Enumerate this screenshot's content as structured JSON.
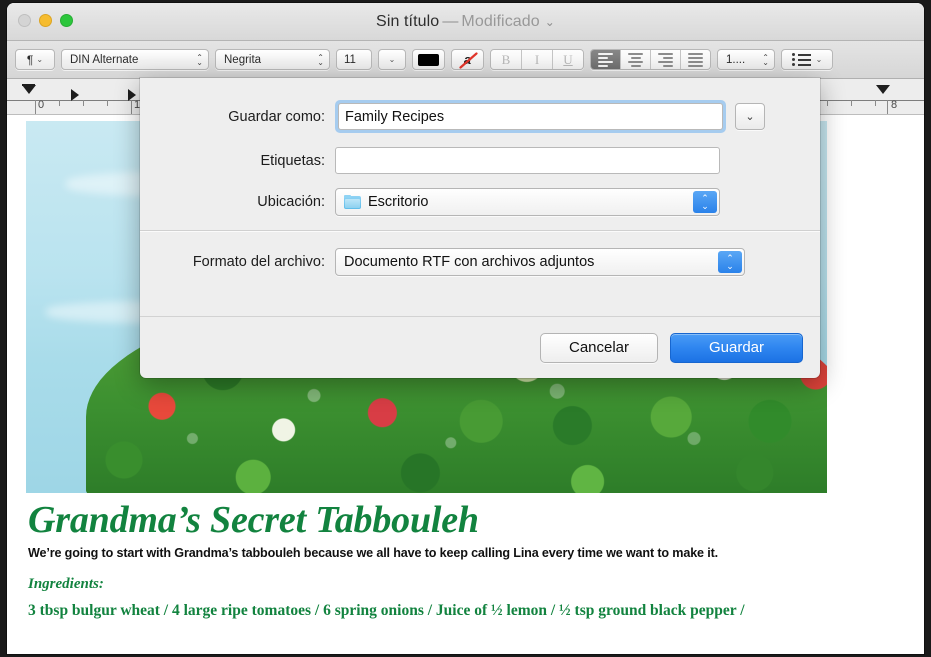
{
  "window": {
    "title_name": "Sin título",
    "title_dash": "—",
    "title_modified": "Modificado",
    "title_chevron": "⌄"
  },
  "traffic_lights": {
    "close": "close-button",
    "minimize": "minimize-button",
    "maximize": "maximize-button"
  },
  "toolbar": {
    "paragraph_glyph": "¶",
    "paragraph_chevron": "⌄",
    "font_family": "DIN Alternate",
    "font_style": "Negrita",
    "font_size": "11",
    "font_size_chevron": "⌄",
    "text_color": "#000000",
    "highlight_glyph": "a",
    "bold": "B",
    "italic": "I",
    "underline": "U",
    "list_spacing": "1....",
    "list_chevron": "⌄",
    "stepper_up": "⌃",
    "stepper_down": "⌄"
  },
  "ruler": {
    "labels": [
      "0",
      "1",
      "8"
    ],
    "unit": "inches"
  },
  "dialog": {
    "save_as_label": "Guardar como:",
    "save_as_value": "Family Recipes",
    "tags_label": "Etiquetas:",
    "tags_value": "",
    "tags_placeholder": "",
    "location_label": "Ubicación:",
    "location_value": "Escritorio",
    "file_format_label": "Formato del archivo:",
    "file_format_value": "Documento RTF con archivos adjuntos",
    "cancel_label": "Cancelar",
    "save_label": "Guardar",
    "disclosure_chevron": "⌄",
    "popup_up": "⌃",
    "popup_down": "⌄",
    "accent_color": "#2f86f0",
    "focus_ring_color": "#a6ccef"
  },
  "document": {
    "headline": "Grandma’s Secret Tabbouleh",
    "body": "We’re going to start with Grandma’s tabbouleh because we all have to keep calling Lina every time we want to make it.",
    "subhead": "Ingredients:",
    "ingredients": "3 tbsp bulgur wheat / 4 large ripe tomatoes / 6 spring onions / Juice of ½ lemon / ½ tsp ground black pepper /",
    "accent_color": "#12833f"
  }
}
